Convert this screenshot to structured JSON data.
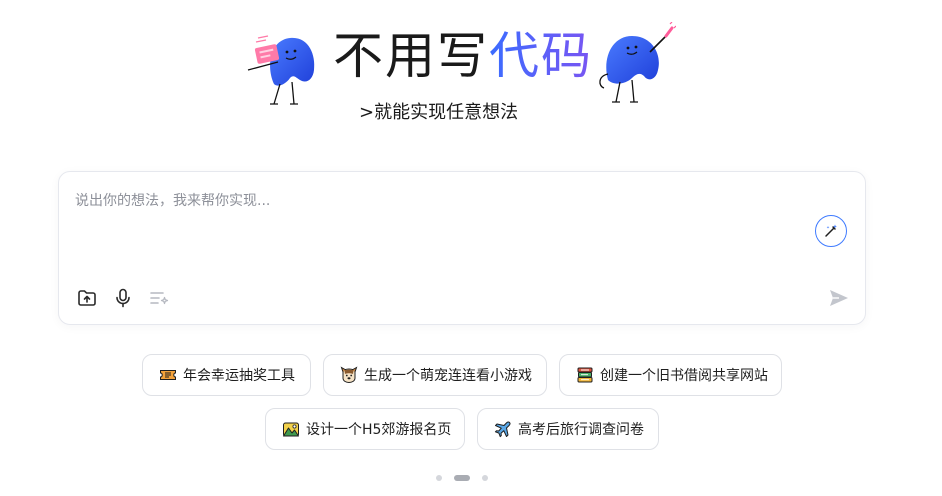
{
  "hero": {
    "title_plain": "不用写",
    "title_highlight": "代码",
    "subtitle": ">就能实现任意想法"
  },
  "input": {
    "placeholder": "说出你的想法，我来帮你实现...",
    "value": ""
  },
  "toolbar": {
    "upload_icon": "upload-folder-icon",
    "mic_icon": "microphone-icon",
    "prompt_icon": "prompt-list-icon",
    "magic_icon": "magic-wand-icon",
    "send_icon": "send-icon"
  },
  "suggestions": [
    {
      "label": "年会幸运抽奖工具",
      "icon": "ticket-icon"
    },
    {
      "label": "生成一个萌宠连连看小游戏",
      "icon": "pet-face-icon"
    },
    {
      "label": "创建一个旧书借阅共享网站",
      "icon": "books-icon"
    },
    {
      "label": "设计一个H5郊游报名页",
      "icon": "park-icon"
    },
    {
      "label": "高考后旅行调查问卷",
      "icon": "airplane-icon"
    }
  ],
  "pagination": {
    "total": 3,
    "current": 2
  },
  "colors": {
    "accent": "#3f7bff",
    "gradient_start": "#3b6cff",
    "gradient_end": "#7a55f2"
  }
}
